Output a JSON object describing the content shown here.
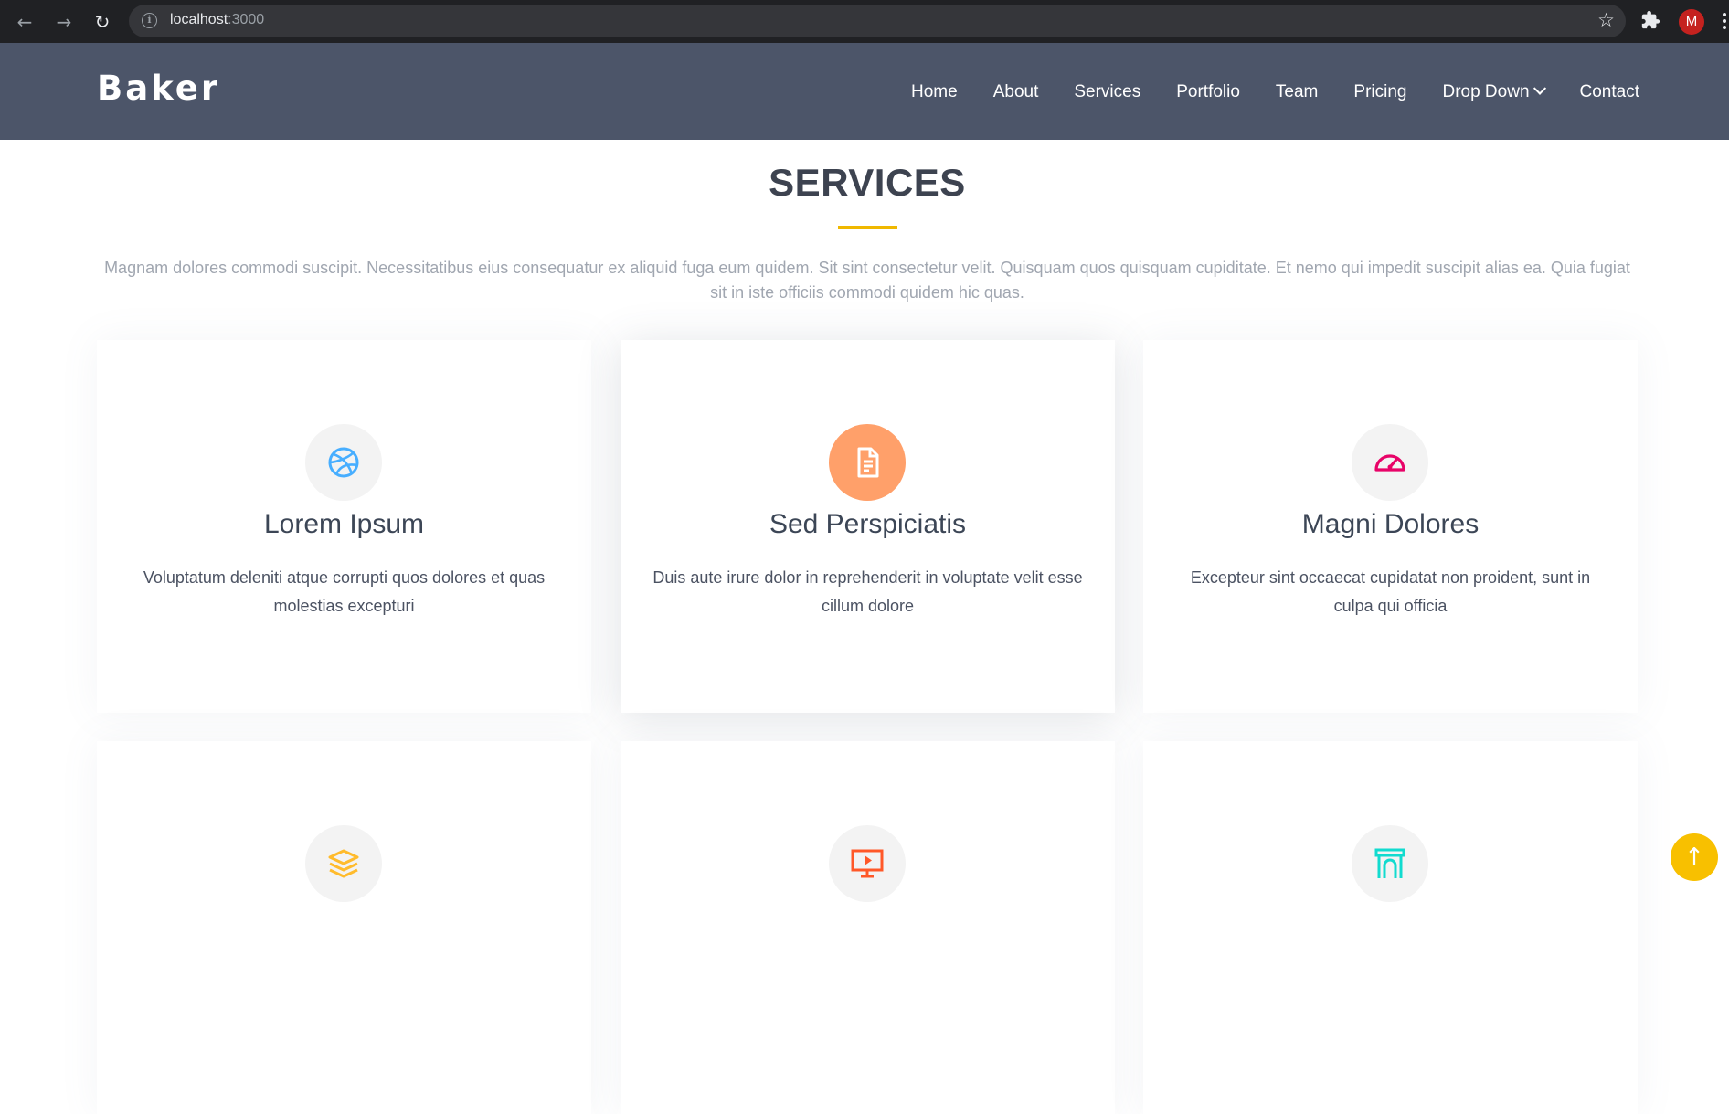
{
  "browser": {
    "url_host": "localhost",
    "url_port": ":3000",
    "avatar_letter": "M"
  },
  "site": {
    "logo": "Baker",
    "nav": [
      {
        "label": "Home"
      },
      {
        "label": "About"
      },
      {
        "label": "Services"
      },
      {
        "label": "Portfolio"
      },
      {
        "label": "Team"
      },
      {
        "label": "Pricing"
      },
      {
        "label": "Drop Down"
      },
      {
        "label": "Contact"
      }
    ]
  },
  "services": {
    "title": "SERVICES",
    "description": "Magnam dolores commodi suscipit. Necessitatibus eius consequatur ex aliquid fuga eum quidem. Sit sint consectetur velit. Quisquam quos quisquam cupiditate. Et nemo qui impedit suscipit alias ea. Quia fugiat sit in iste officiis commodi quidem hic quas.",
    "cards": [
      {
        "title": "Lorem Ipsum",
        "description": "Voluptatum deleniti atque corrupti quos dolores et quas molestias excepturi",
        "icon": "dribbble-icon",
        "icon_color": "#47aeff"
      },
      {
        "title": "Sed Perspiciatis",
        "description": "Duis aute irure dolor in reprehenderit in voluptate velit esse cillum dolore",
        "icon": "file-text-icon",
        "icon_color": "#ffffff"
      },
      {
        "title": "Magni Dolores",
        "description": "Excepteur sint occaecat cupidatat non proident, sunt in culpa qui officia",
        "icon": "speedometer-icon",
        "icon_color": "#e80368"
      },
      {
        "title": "",
        "description": "",
        "icon": "layers-icon",
        "icon_color": "#ffbb2c"
      },
      {
        "title": "",
        "description": "",
        "icon": "presentation-icon",
        "icon_color": "#ff5828"
      },
      {
        "title": "",
        "description": "",
        "icon": "arch-icon",
        "icon_color": "#11dbcf"
      }
    ]
  },
  "colors": {
    "header_bg": "#4c5569",
    "accent": "#f0b800",
    "featured_icon_bg": "#ffa06a"
  }
}
